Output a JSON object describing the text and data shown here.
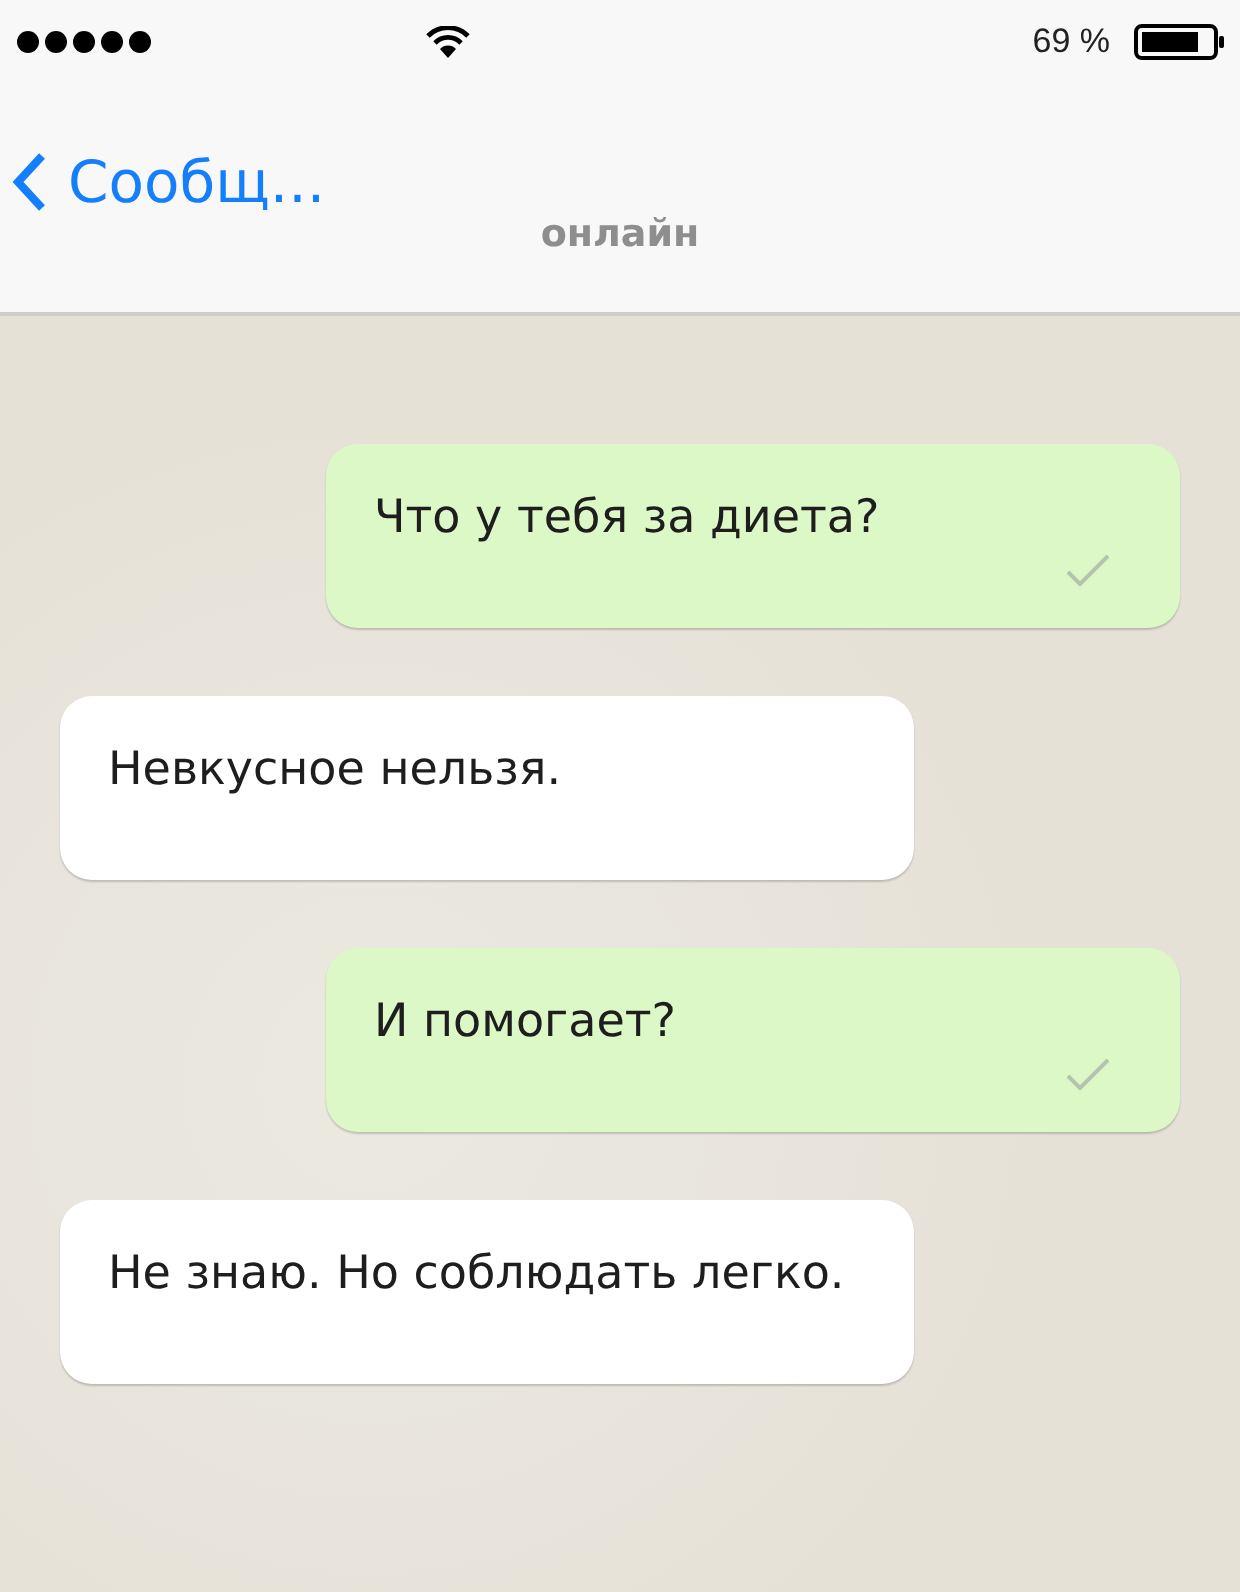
{
  "status_bar": {
    "battery_text": "69 %"
  },
  "header": {
    "back_label": "Сообщ...",
    "subtitle": "онлайн"
  },
  "messages": [
    {
      "kind": "outgoing",
      "text": "Что у тебя за диета?"
    },
    {
      "kind": "incoming",
      "text": "Невкусное нельзя."
    },
    {
      "kind": "outgoing",
      "text": "И помогает?"
    },
    {
      "kind": "incoming",
      "text": "Не знаю. Но соблюдать легко."
    }
  ]
}
